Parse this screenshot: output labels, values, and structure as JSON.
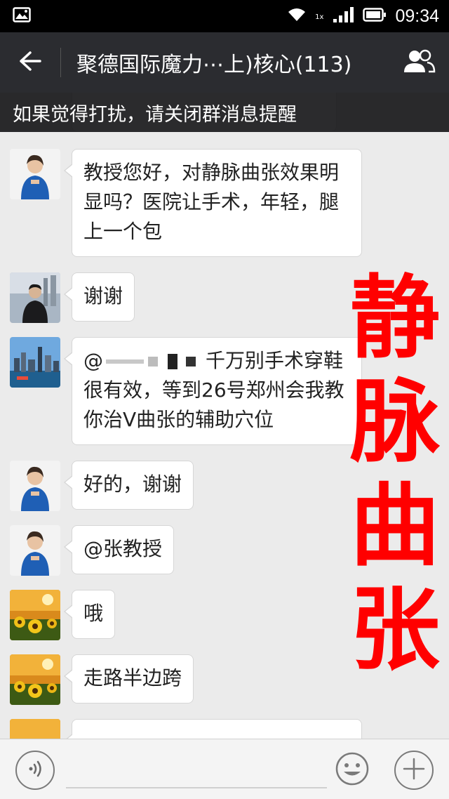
{
  "status_bar": {
    "time": "09:34",
    "signal_label": "1x",
    "icons": [
      "image-icon",
      "wifi-icon",
      "signal-icon",
      "battery-icon"
    ]
  },
  "header": {
    "back_icon": "arrow-left-icon",
    "title": "聚德国际魔力⋯上)核心(113)",
    "members_icon": "group-members-icon"
  },
  "banner": {
    "text": "如果觉得打扰，请关闭群消息提醒"
  },
  "messages": [
    {
      "sender": "avatar-woman-blue",
      "text": "教授您好，对静脉曲张效果明显吗？医院让手术，年轻，腿上一个包"
    },
    {
      "sender": "avatar-man-suit",
      "text": "谢谢"
    },
    {
      "sender": "avatar-city-skyline",
      "text_prefix": "@",
      "text": "千万别手术穿鞋很有效，等到26号郑州会我教你治V曲张的辅助穴位"
    },
    {
      "sender": "avatar-woman-blue",
      "text": "好的，谢谢"
    },
    {
      "sender": "avatar-woman-blue",
      "text": "@张教授"
    },
    {
      "sender": "avatar-sunflower",
      "text": "哦"
    },
    {
      "sender": "avatar-sunflower",
      "text": "走路半边跨"
    }
  ],
  "overlay": {
    "chars": [
      "静",
      "脉",
      "曲",
      "张"
    ],
    "color": "#ff0000"
  },
  "input_bar": {
    "voice_icon": "voice-icon",
    "emoji_icon": "emoji-icon",
    "plus_icon": "plus-icon"
  },
  "colors": {
    "header_bg": "#2b2c30",
    "chat_bg": "#ebebeb",
    "bubble_bg": "#ffffff"
  }
}
